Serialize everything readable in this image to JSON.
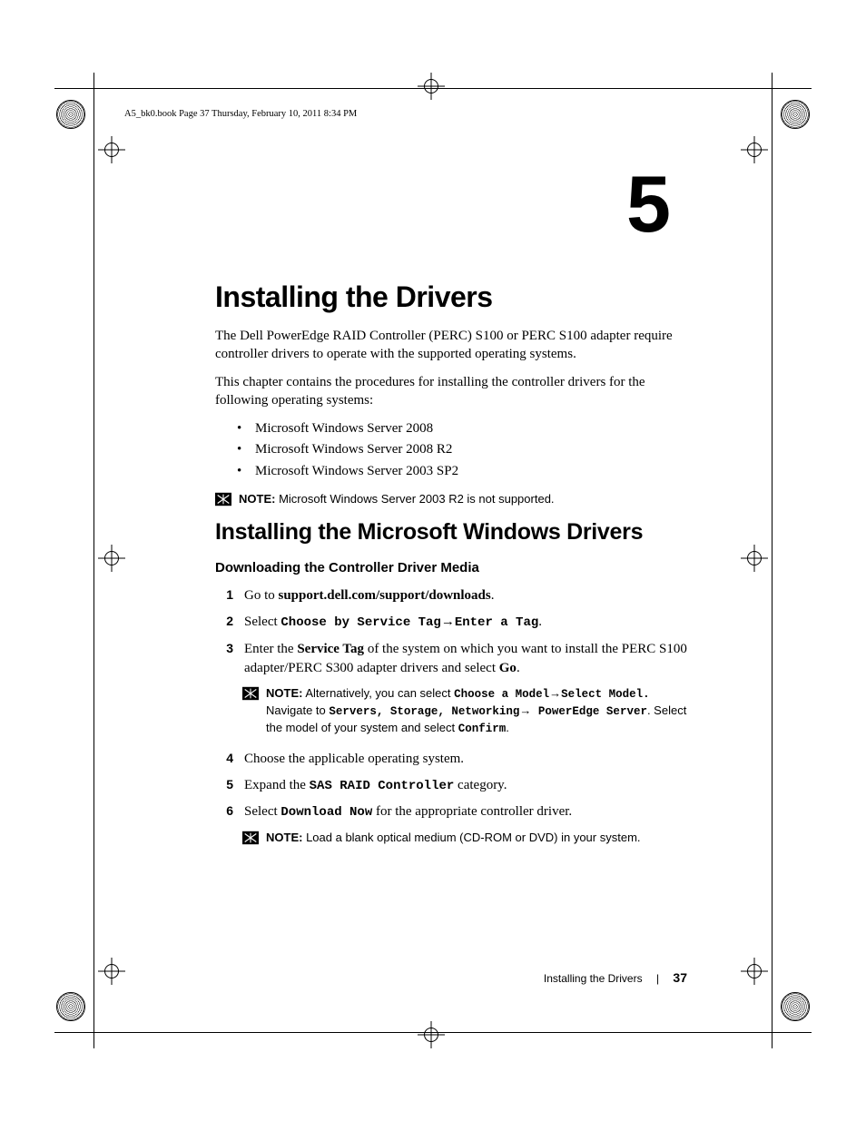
{
  "running_head": "A5_bk0.book  Page 37  Thursday, February 10, 2011  8:34 PM",
  "chapter_number": "5",
  "h1": "Installing the Drivers",
  "intro_p1": "The Dell PowerEdge RAID Controller (PERC) S100 or PERC S100 adapter require controller drivers to operate with the supported operating systems.",
  "intro_p2": "This chapter contains the procedures for installing the controller drivers for the following operating systems:",
  "bullets": {
    "b0": "Microsoft Windows Server 2008",
    "b1": "Microsoft Windows Server 2008 R2",
    "b2": "Microsoft Windows Server 2003 SP2"
  },
  "note1_label": "NOTE:",
  "note1_text": " Microsoft Windows Server 2003 R2 is not supported.",
  "h2": "Installing the Microsoft Windows Drivers",
  "h3": "Downloading the Controller Driver Media",
  "steps": {
    "s1_a": "Go to ",
    "s1_b": "support.dell.com/support/downloads",
    "s1_c": ".",
    "s2_a": "Select ",
    "s2_b": "Choose by Service Tag",
    "s2_arrow": "→",
    "s2_c": "Enter a Tag",
    "s2_d": ".",
    "s3_a": "Enter the ",
    "s3_b": "Service Tag",
    "s3_c": " of the system on which you want to install the PERC S100 adapter/PERC S300 adapter drivers and select ",
    "s3_d": "Go",
    "s3_e": ".",
    "s4": "Choose the applicable operating system.",
    "s5_a": "Expand the ",
    "s5_b": "SAS RAID Controller",
    "s5_c": " category.",
    "s6_a": "Select ",
    "s6_b": "Download Now",
    "s6_c": " for the appropriate controller driver."
  },
  "note2_label": "NOTE:",
  "note2": {
    "a": " Alternatively, you can select ",
    "b": "Choose a Model",
    "arrow": "→",
    "c": "Select Model.",
    "d": " Navigate to ",
    "e": "Servers, Storage, Networking",
    "f": " PowerEdge Server",
    "g": ". Select the model of your system and select ",
    "h": "Confirm",
    "i": "."
  },
  "note3_label": "NOTE:",
  "note3_text": " Load a blank optical medium (CD-ROM or DVD) in your system.",
  "footer": {
    "title": "Installing the Drivers",
    "sep": "|",
    "page": "37"
  }
}
